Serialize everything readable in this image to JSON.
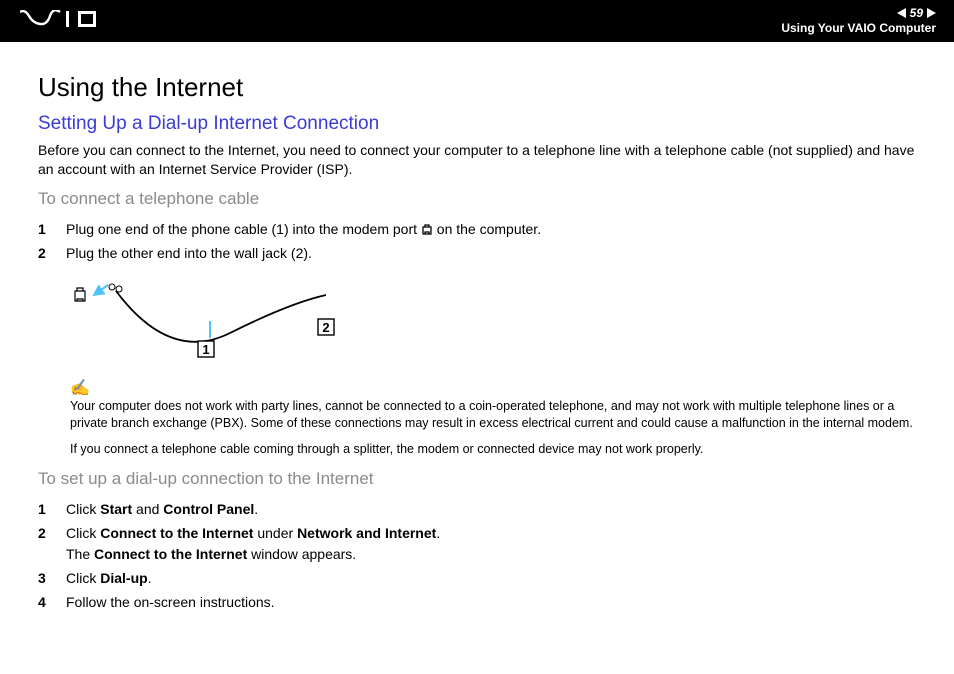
{
  "header": {
    "page_number": "59",
    "breadcrumb": "Using Your VAIO Computer"
  },
  "content": {
    "title": "Using the Internet",
    "subtitle": "Setting Up a Dial-up Internet Connection",
    "intro": "Before you can connect to the Internet, you need to connect your computer to a telephone line with a telephone cable (not supplied) and have an account with an Internet Service Provider (ISP).",
    "section1_title": "To connect a telephone cable",
    "steps1": {
      "s1_before": "Plug one end of the phone cable (1) into the modem port ",
      "s1_after": " on the computer.",
      "s2": "Plug the other end into the wall jack (2)."
    },
    "note1": "Your computer does not work with party lines, cannot be connected to a coin-operated telephone, and may not work with multiple telephone lines or a private branch exchange (PBX). Some of these connections may result in excess electrical current and could cause a malfunction in the internal modem.",
    "note2": "If you connect a telephone cable coming through a splitter, the modem or connected device may not work properly.",
    "section2_title": "To set up a dial-up connection to the Internet",
    "steps2": {
      "s1_a": "Click ",
      "s1_b": "Start",
      "s1_c": " and ",
      "s1_d": "Control Panel",
      "s1_e": ".",
      "s2_a": "Click ",
      "s2_b": "Connect to the Internet",
      "s2_c": " under ",
      "s2_d": "Network and Internet",
      "s2_e": ".",
      "s2_f": "The ",
      "s2_g": "Connect to the Internet",
      "s2_h": " window appears.",
      "s3_a": "Click ",
      "s3_b": "Dial-up",
      "s3_c": ".",
      "s4": "Follow the on-screen instructions."
    }
  }
}
